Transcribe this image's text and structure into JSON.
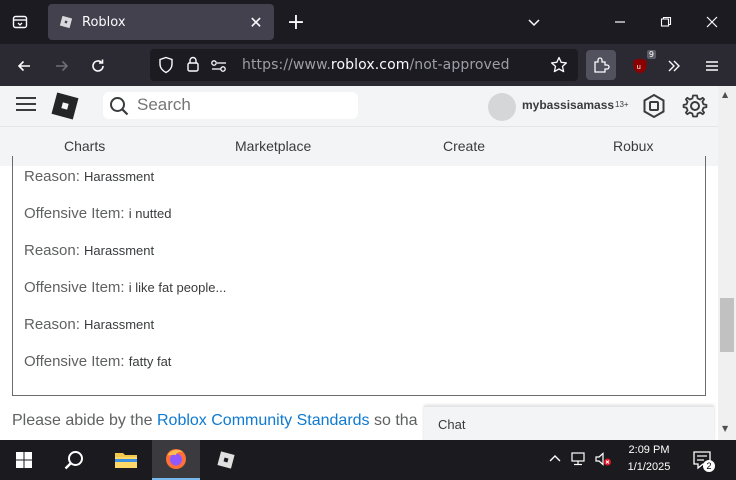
{
  "browser": {
    "tab_title": "Roblox",
    "url_domain": "https://www.",
    "url_host": "roblox.com",
    "url_path": "/not-approved",
    "extension_badge": "9"
  },
  "header": {
    "search_placeholder": "Search",
    "username": "mybassisamass",
    "age_label": "13+"
  },
  "nav": {
    "charts": "Charts",
    "marketplace": "Marketplace",
    "create": "Create",
    "robux": "Robux"
  },
  "moderation": {
    "lines": [
      {
        "label": "Reason:",
        "value": "Harassment"
      },
      {
        "label": "Offensive Item:",
        "value": "i nutted"
      },
      {
        "label": "Reason:",
        "value": "Harassment"
      },
      {
        "label": "Offensive Item:",
        "value": "i like fat people..."
      },
      {
        "label": "Reason:",
        "value": "Harassment"
      },
      {
        "label": "Offensive Item:",
        "value": "fatty fat"
      }
    ],
    "abide_prefix": "Please abide by the ",
    "abide_link": "Roblox Community Standards",
    "abide_suffix": " so tha"
  },
  "chat": {
    "label": "Chat"
  },
  "taskbar": {
    "time": "2:09 PM",
    "date": "1/1/2025",
    "notification_count": "2"
  }
}
